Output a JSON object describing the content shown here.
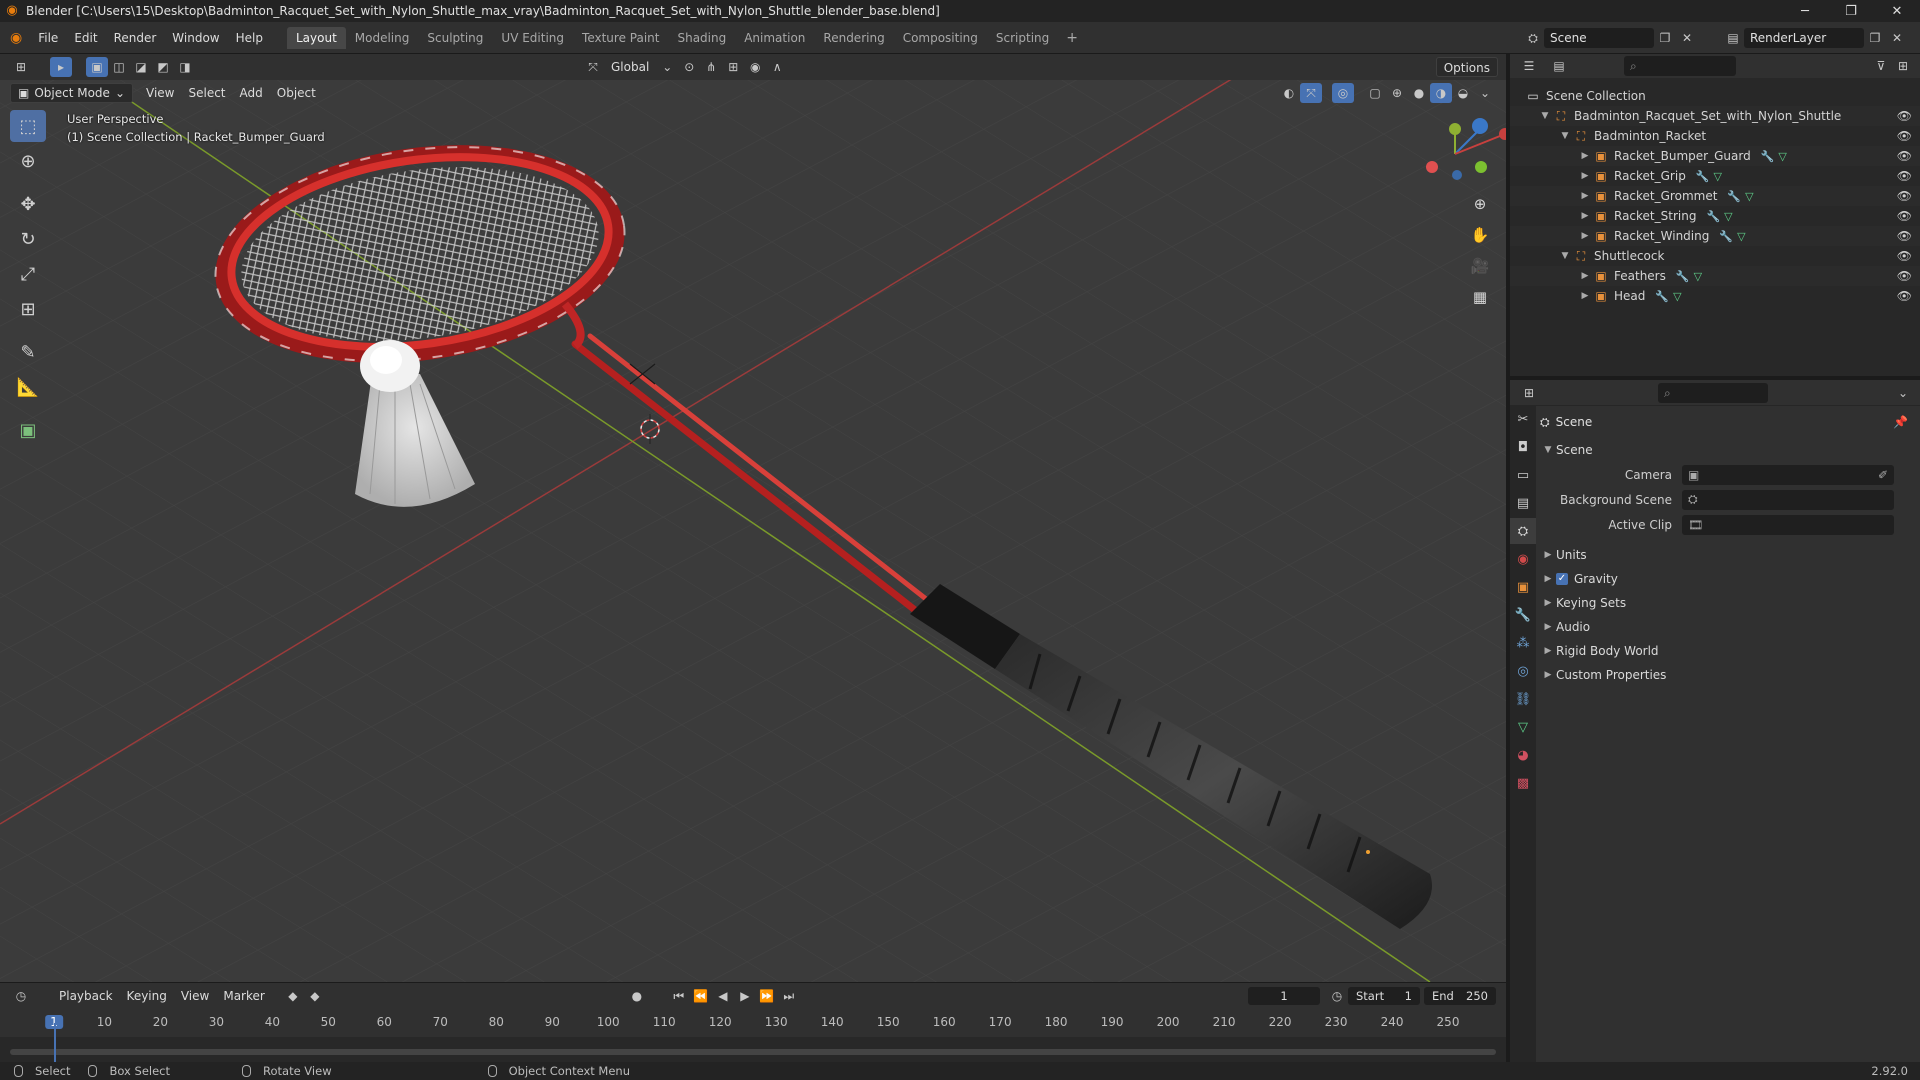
{
  "titlebar": {
    "title": "Blender [C:\\Users\\15\\Desktop\\Badminton_Racquet_Set_with_Nylon_Shuttle_max_vray\\Badminton_Racquet_Set_with_Nylon_Shuttle_blender_base.blend]",
    "minimize": "─",
    "maximize": "❐",
    "close": "✕"
  },
  "menu": [
    "File",
    "Edit",
    "Render",
    "Window",
    "Help"
  ],
  "workspaces": [
    "Layout",
    "Modeling",
    "Sculpting",
    "UV Editing",
    "Texture Paint",
    "Shading",
    "Animation",
    "Rendering",
    "Compositing",
    "Scripting"
  ],
  "workspace_add": "+",
  "active_workspace": "Layout",
  "scene_selector": "Scene",
  "render_layer": "RenderLayer",
  "viewport": {
    "mode": "Object Mode",
    "menus": [
      "View",
      "Select",
      "Add",
      "Object"
    ],
    "transform_orientation": "Global",
    "options_label": "Options",
    "perspective": "User Perspective",
    "collection_info": "(1) Scene Collection | Racket_Bumper_Guard"
  },
  "outliner": {
    "root": "Scene Collection",
    "items": [
      {
        "label": "Badminton_Racquet_Set_with_Nylon_Shuttle",
        "level": 1,
        "kind": "collection"
      },
      {
        "label": "Badminton_Racket",
        "level": 2,
        "kind": "empty"
      },
      {
        "label": "Racket_Bumper_Guard",
        "level": 3,
        "kind": "mesh"
      },
      {
        "label": "Racket_Grip",
        "level": 3,
        "kind": "mesh"
      },
      {
        "label": "Racket_Grommet",
        "level": 3,
        "kind": "mesh"
      },
      {
        "label": "Racket_String",
        "level": 3,
        "kind": "mesh"
      },
      {
        "label": "Racket_Winding",
        "level": 3,
        "kind": "mesh"
      },
      {
        "label": "Shuttlecock",
        "level": 2,
        "kind": "empty"
      },
      {
        "label": "Feathers",
        "level": 3,
        "kind": "mesh"
      },
      {
        "label": "Head",
        "level": 3,
        "kind": "mesh"
      }
    ]
  },
  "properties": {
    "context": "Scene",
    "panel": "Scene",
    "fields": [
      {
        "label": "Camera",
        "value": ""
      },
      {
        "label": "Background Scene",
        "value": ""
      },
      {
        "label": "Active Clip",
        "value": ""
      }
    ],
    "sections": [
      "Units",
      "Gravity",
      "Keying Sets",
      "Audio",
      "Rigid Body World",
      "Custom Properties"
    ]
  },
  "timeline": {
    "menus": [
      "Playback",
      "Keying",
      "View",
      "Marker"
    ],
    "current_frame": "1",
    "start_label": "Start",
    "start": "1",
    "end_label": "End",
    "end": "250",
    "ruler": [
      "1",
      "10",
      "20",
      "30",
      "40",
      "50",
      "60",
      "70",
      "80",
      "90",
      "100",
      "110",
      "120",
      "130",
      "140",
      "150",
      "160",
      "170",
      "180",
      "190",
      "200",
      "210",
      "220",
      "230",
      "240",
      "250"
    ]
  },
  "statusbar": {
    "items": [
      "Select",
      "Box Select",
      "Rotate View",
      "Object Context Menu"
    ],
    "version": "2.92.0"
  },
  "colors": {
    "accent": "#4772b3",
    "racket_red": "#c8282a",
    "grip_black": "#1e1e1e"
  }
}
